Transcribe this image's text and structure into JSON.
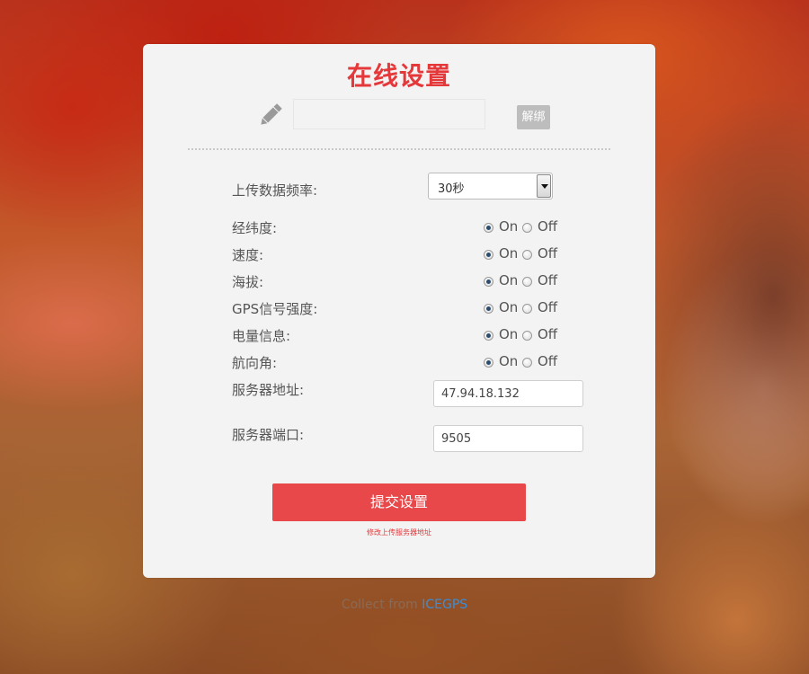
{
  "page": {
    "title": "在线设置"
  },
  "bind": {
    "input_value": "",
    "unbind_label": "解绑"
  },
  "upload_frequency": {
    "label": "上传数据频率:",
    "selected": "30秒"
  },
  "toggles": [
    {
      "label": "经纬度:",
      "on_label": "On",
      "off_label": "Off",
      "value": "On"
    },
    {
      "label": "速度:",
      "on_label": "On",
      "off_label": "Off",
      "value": "On"
    },
    {
      "label": "海拔:",
      "on_label": "On",
      "off_label": "Off",
      "value": "On"
    },
    {
      "label": "GPS信号强度:",
      "on_label": "On",
      "off_label": "Off",
      "value": "On"
    },
    {
      "label": "电量信息:",
      "on_label": "On",
      "off_label": "Off",
      "value": "On"
    },
    {
      "label": "航向角:",
      "on_label": "On",
      "off_label": "Off",
      "value": "On"
    }
  ],
  "server": {
    "address_label": "服务器地址:",
    "address_value": "47.94.18.132",
    "port_label": "服务器端口:",
    "port_value": "9505"
  },
  "actions": {
    "submit_label": "提交设置",
    "hint": "修改上传服务器地址"
  },
  "footer": {
    "prefix": "Collect from ",
    "link": "ICEGPS"
  },
  "colors": {
    "accent": "#e5383b",
    "button": "#e8484a",
    "link": "#3a8ed8"
  },
  "icons": {
    "edit": "pencil-icon"
  }
}
